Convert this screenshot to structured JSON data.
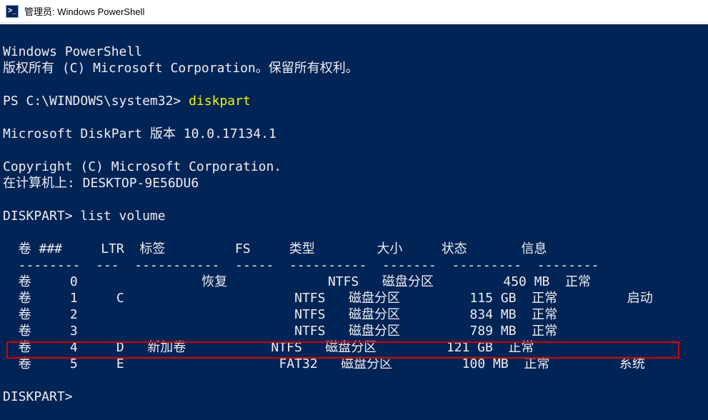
{
  "titlebar": {
    "icon_glyph": ">_",
    "title": "管理员: Windows PowerShell"
  },
  "terminal": {
    "header1": "Windows PowerShell",
    "header2": "版权所有 (C) Microsoft Corporation。保留所有权利。",
    "blank": "",
    "prompt1_prefix": "PS C:\\WINDOWS\\system32> ",
    "prompt1_cmd": "diskpart",
    "diskpart_version": "Microsoft DiskPart 版本 10.0.17134.1",
    "copyright": "Copyright (C) Microsoft Corporation.",
    "computer": "在计算机上: DESKTOP-9E56DU6",
    "prompt2": "DISKPART> list volume",
    "table_header": "  卷 ###     LTR  标签         FS     类型        大小     状态       信息",
    "table_divider": "  --------  ---  -----------  -----  ----------  -------  ---------  --------",
    "rows": [
      "  卷     0                恢复             NTFS   磁盘分区         450 MB  正常",
      "  卷     1     C                      NTFS   磁盘分区         115 GB  正常         启动",
      "  卷     2                            NTFS   磁盘分区         834 MB  正常",
      "  卷     3                            NTFS   磁盘分区         789 MB  正常",
      "  卷     4     D   新加卷           NTFS   磁盘分区         121 GB  正常",
      "  卷     5     E                    FAT32   磁盘分区         100 MB  正常         系统"
    ],
    "prompt3": "DISKPART>"
  },
  "highlight": {
    "top": "444",
    "left": "9",
    "width": "942",
    "height": "24"
  }
}
